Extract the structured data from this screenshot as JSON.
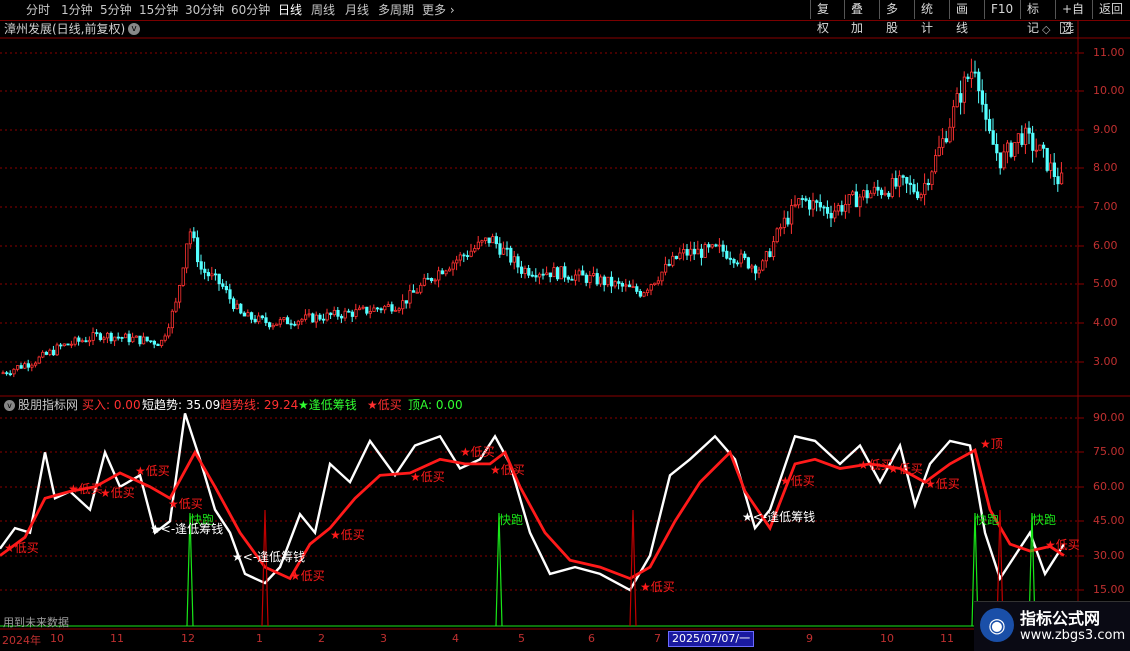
{
  "toolbar": {
    "periods": [
      {
        "label": "分时",
        "active": false
      },
      {
        "label": "1分钟",
        "active": false
      },
      {
        "label": "5分钟",
        "active": false
      },
      {
        "label": "15分钟",
        "active": false
      },
      {
        "label": "30分钟",
        "active": false
      },
      {
        "label": "60分钟",
        "active": false
      },
      {
        "label": "日线",
        "active": true
      },
      {
        "label": "周线",
        "active": false
      },
      {
        "label": "月线",
        "active": false
      },
      {
        "label": "多周期",
        "active": false
      }
    ],
    "more_label": "更多",
    "right_buttons": [
      "复权",
      "叠加",
      "多股",
      "统计",
      "画线",
      "F10",
      "标记",
      "+自选",
      "返回"
    ]
  },
  "price_panel": {
    "title": "漳州发展(日线,前复权)",
    "y_axis": [
      "11.00",
      "10.00",
      "9.00",
      "8.00",
      "7.00",
      "6.00",
      "5.00",
      "4.00",
      "3.00"
    ]
  },
  "indicator_panel": {
    "legend": [
      {
        "label": "股朋指标网",
        "color": "#c8c8c8"
      },
      {
        "label": "买入: 0.00",
        "color": "#ff3030"
      },
      {
        "label": "短趋势: 35.09",
        "color": "#ffffff"
      },
      {
        "label": "趋势线: 29.24",
        "color": "#ff3030"
      },
      {
        "label": "★逢低筹钱",
        "color": "#30ff30"
      },
      {
        "label": "★低买",
        "color": "#ff3030"
      },
      {
        "label": "顶A: 0.00",
        "color": "#30ff30"
      }
    ],
    "y_axis": [
      "90.00",
      "75.00",
      "60.00",
      "45.00",
      "30.00",
      "15.00"
    ],
    "annotations": {
      "low_buy": "低买",
      "escape": "快跑",
      "top": "顶",
      "fund": "逢低筹钱",
      "fund_prefix": "<-",
      "future_data": "用到未来数据"
    }
  },
  "date_axis": {
    "year_label": "2024年",
    "months": [
      "10",
      "11",
      "12",
      "1",
      "2",
      "3",
      "4",
      "5",
      "6",
      "7",
      "9",
      "10",
      "11"
    ],
    "cursor_date": "2025/07/07/一"
  },
  "watermark": {
    "title": "指标公式网",
    "url": "www.zbgs3.com"
  },
  "colors": {
    "up": "#ff3232",
    "down": "#54ffff",
    "grid": "#8a0000",
    "white": "#ffffff",
    "red": "#ff1a1a",
    "green": "#19e619"
  }
}
